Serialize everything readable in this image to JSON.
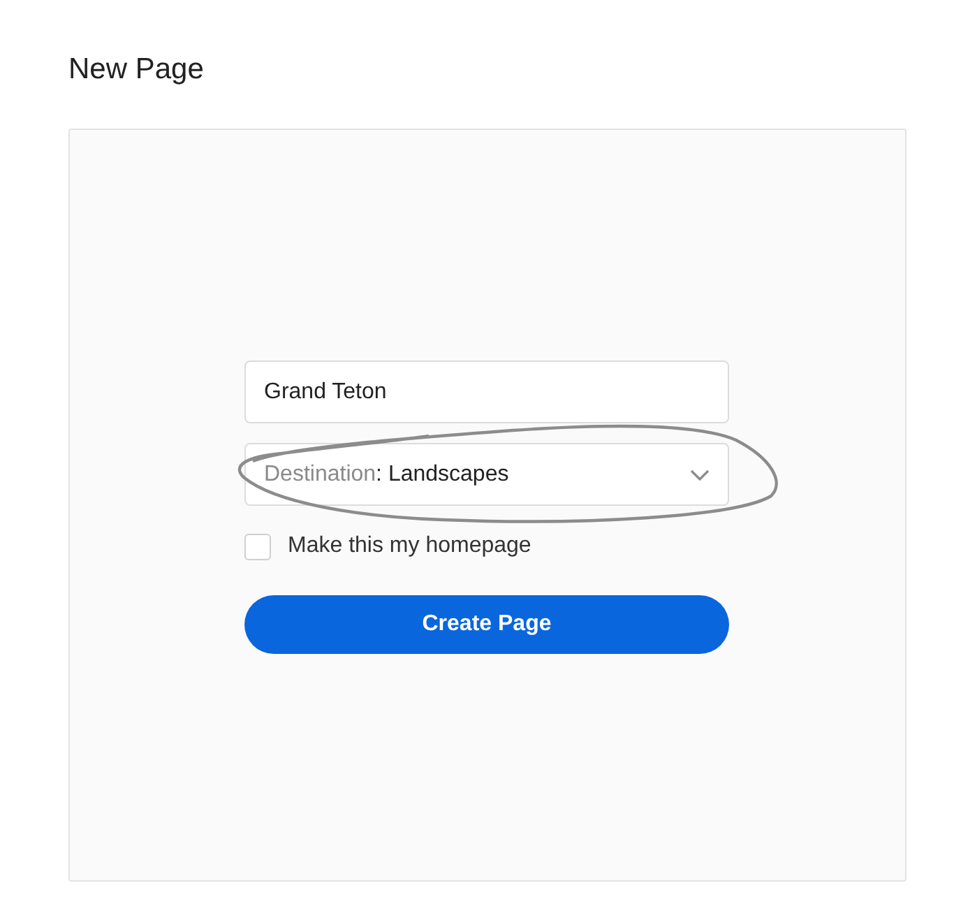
{
  "title": "New Page",
  "name_field": {
    "value": "Grand Teton"
  },
  "destination": {
    "label": "Destination",
    "value": ": Landscapes"
  },
  "homepage_checkbox": {
    "label": "Make this my homepage",
    "checked": false
  },
  "submit_button": {
    "label": "Create Page"
  }
}
